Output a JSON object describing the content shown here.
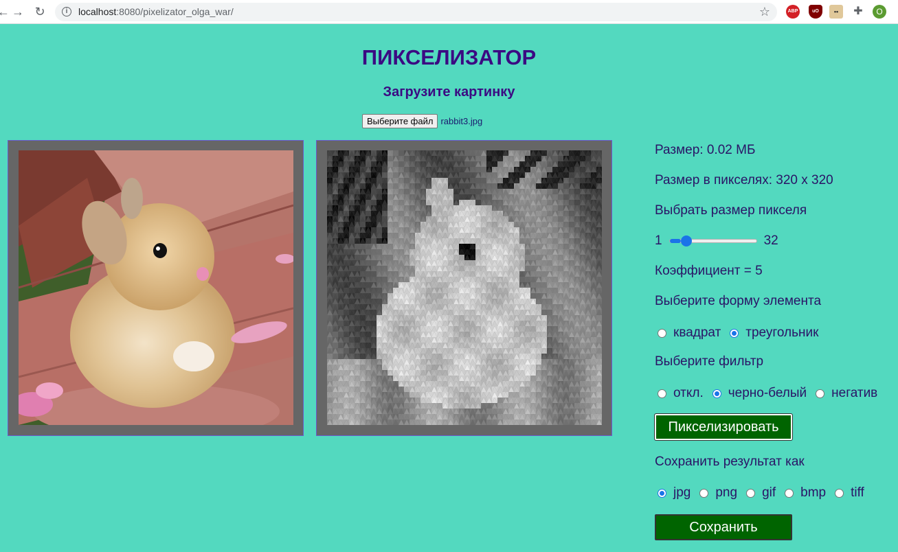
{
  "browser": {
    "url_host": "localhost",
    "url_rest": ":8080/pixelizator_olga_war/",
    "extensions": [
      "ABP",
      "uO"
    ],
    "profile_initial": "O"
  },
  "page": {
    "title": "ПИКСЕЛИЗАТОР",
    "subtitle": "Загрузите картинку",
    "file_button": "Выберите файл",
    "file_name": "rabbit3.jpg"
  },
  "panel": {
    "size": "Размер: 0.02 МБ",
    "pixel_size": "Размер в пикселях: 320 x 320",
    "choose_pixel_size": "Выбрать размер пикселя",
    "slider_min": "1",
    "slider_max": "32",
    "slider_value": 5,
    "coefficient": "Коэффициент = 5",
    "shape_title": "Выберите форму элемента",
    "shapes": [
      {
        "label": "квадрат",
        "checked": false
      },
      {
        "label": "треугольник",
        "checked": true
      }
    ],
    "filter_title": "Выберите фильтр",
    "filters": [
      {
        "label": "откл.",
        "checked": false
      },
      {
        "label": "черно-белый",
        "checked": true
      },
      {
        "label": "негатив",
        "checked": false
      }
    ],
    "pixelize_button": "Пикселизировать",
    "save_title": "Сохранить результат как",
    "formats": [
      {
        "label": "jpg",
        "checked": true
      },
      {
        "label": "png",
        "checked": false
      },
      {
        "label": "gif",
        "checked": false
      },
      {
        "label": "bmp",
        "checked": false
      },
      {
        "label": "tiff",
        "checked": false
      }
    ],
    "save_button": "Сохранить"
  }
}
